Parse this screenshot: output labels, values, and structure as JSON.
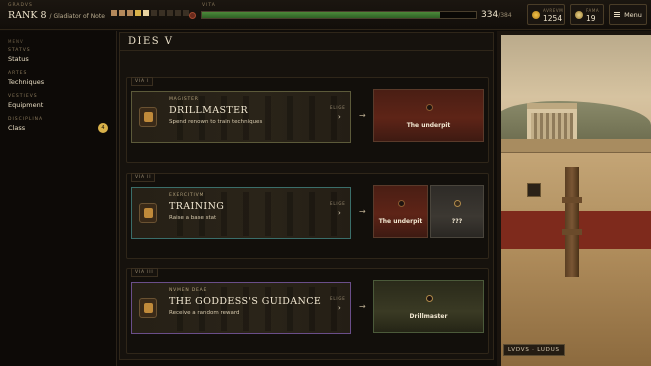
{
  "header": {
    "grade_label": "GRADVS",
    "rank": "RANK 8",
    "rank_title": "/ Gladiator of Note",
    "pips": [
      "#b4885a",
      "#b4885a",
      "#b4885a",
      "#d9b24a",
      "#e8d3a0",
      "#3a3024",
      "#3a3024",
      "#3a3024",
      "#3a3024",
      "#3a3024"
    ],
    "vita_label": "VITA",
    "vita_current": "334",
    "vita_max": "/384",
    "vita_fraction": 0.87,
    "aureus_label": "AVREVM",
    "aureus_value": "1254",
    "fama_label": "FAMA",
    "fama_value": "19",
    "menu_label": "Menu"
  },
  "sidebar": {
    "heading": "MENV",
    "items": [
      {
        "latin": "STATVS",
        "name": "Status"
      },
      {
        "latin": "ARTES",
        "name": "Techniques"
      },
      {
        "latin": "VESTIEVS",
        "name": "Equipment"
      },
      {
        "latin": "DISCIPLINA",
        "name": "Class"
      }
    ],
    "class_badge": "4"
  },
  "main": {
    "day_title": "DIES V",
    "vias": [
      {
        "label": "VIA I",
        "choice": {
          "kicker": "MAGISTER",
          "title": "DRILLMASTER",
          "desc": "Spend renown to train techniques",
          "elige": "ELIGE"
        },
        "destinations": [
          "The underpit"
        ]
      },
      {
        "label": "VIA II",
        "choice": {
          "kicker": "EXERCITIVM",
          "title": "TRAINING",
          "desc": "Raise a base stat",
          "elige": "ELIGE"
        },
        "destinations": [
          "The underpit",
          "???"
        ]
      },
      {
        "label": "VIA III",
        "choice": {
          "kicker": "NVMEN DEAE",
          "title": "THE GODDESS'S GUIDANCE",
          "desc": "Receive a random reward",
          "elige": "ELIGE"
        },
        "destinations": [
          "Drillmaster"
        ]
      }
    ]
  },
  "scene": {
    "label": "LVDVS · LUDUS"
  },
  "icons": {
    "vita": "heart-icon",
    "aureus": "coin-icon",
    "fama": "laurel-icon",
    "menu": "hamburger-icon",
    "arrow": "right-arrow-icon",
    "chevron": "chevron-right-icon"
  },
  "colors": {
    "accent_gold": "#d9b24a",
    "vita_green": "#4d8a3a",
    "dest_red": "#5e2417"
  }
}
